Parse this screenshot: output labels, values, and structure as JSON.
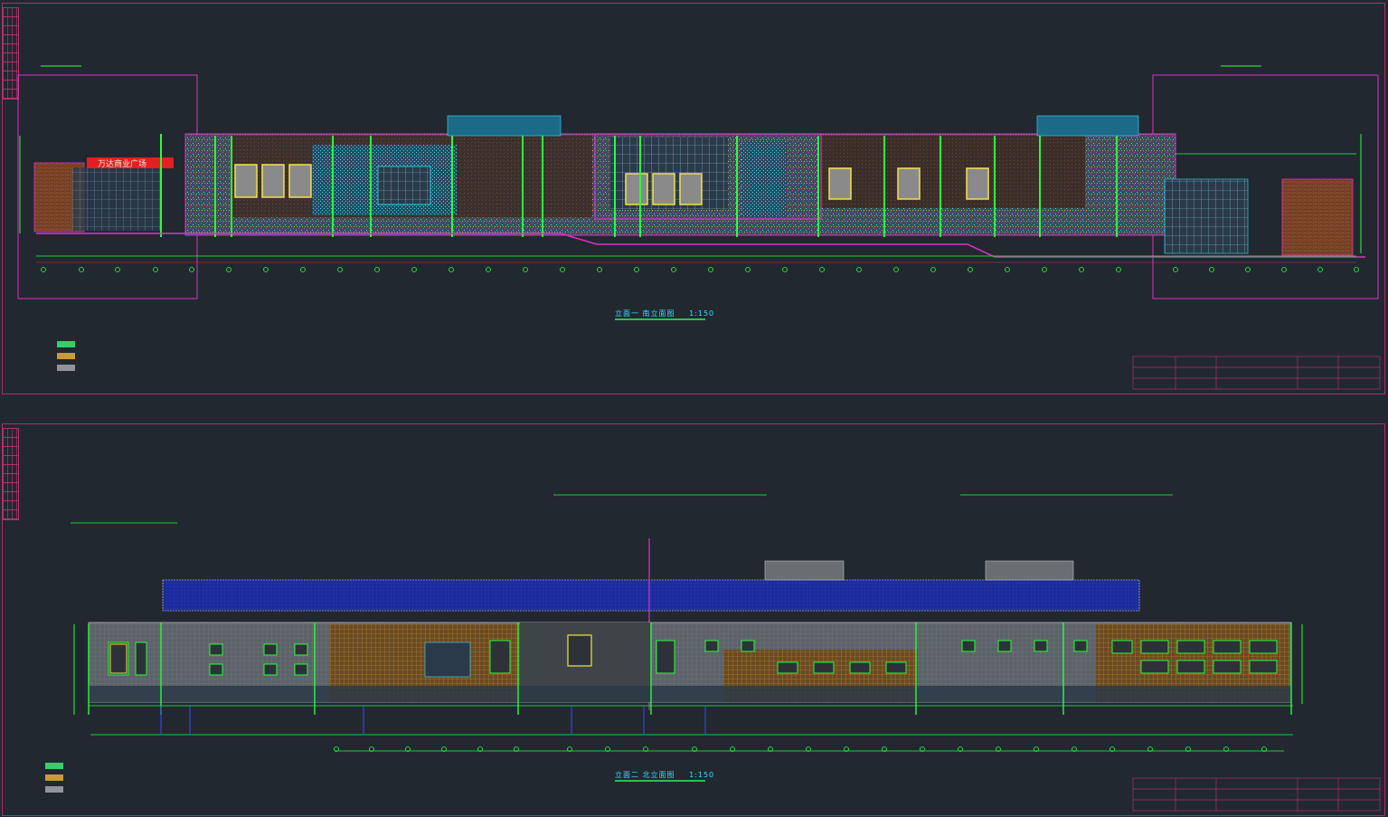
{
  "drawing": {
    "sheets": [
      {
        "caption": "立面一 南立面图",
        "scale": "1:150",
        "sign_text": "万达商业广场",
        "legend": [
          {
            "swatch": "#33d06a",
            "label": ""
          },
          {
            "swatch": "#c89a3a",
            "label": ""
          },
          {
            "swatch": "#8f959a",
            "label": ""
          }
        ]
      },
      {
        "caption": "立面二 北立面图",
        "scale": "1:150",
        "legend": [
          {
            "swatch": "#33d06a",
            "label": ""
          },
          {
            "swatch": "#c89a3a",
            "label": ""
          },
          {
            "swatch": "#8f959a",
            "label": ""
          }
        ]
      }
    ],
    "colors": {
      "background": "#212830",
      "frame": "#b0306a",
      "magenta": "#e030c8",
      "green": "#26ff3a",
      "cyan": "#38e0ff",
      "yellow": "#f2e24a",
      "facade_dark": "#3a2a26",
      "facade_brown": "#6a4a2a",
      "facade_gray": "#5c6268",
      "roof_blue": "#1a2a9a",
      "sign_red": "#e22020"
    }
  }
}
